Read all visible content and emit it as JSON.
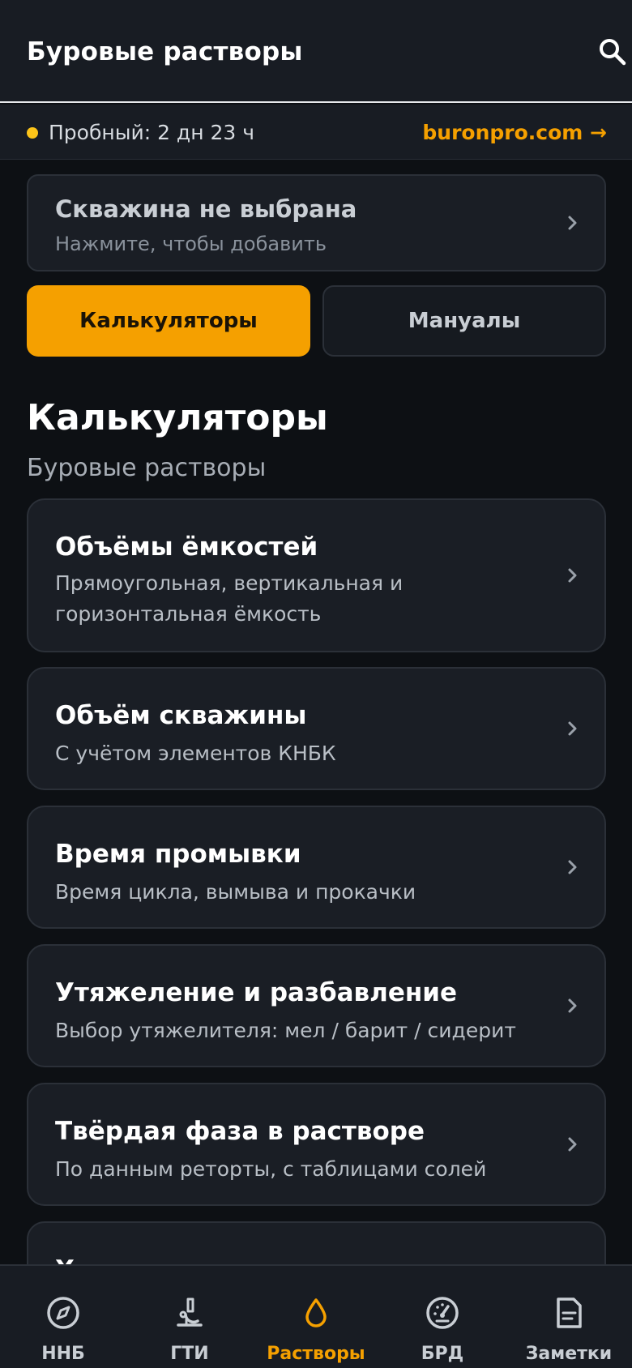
{
  "header": {
    "title": "Буровые растворы",
    "search_icon": "search-icon"
  },
  "trial": {
    "text": "Пробный: 2 дн 23 ч",
    "link": "buronpro.com →",
    "dot_color": "#fcc419"
  },
  "well": {
    "title": "Скважина не выбрана",
    "subtitle": "Нажмите, чтобы добавить"
  },
  "tabs": [
    {
      "label": "Калькуляторы",
      "active": true
    },
    {
      "label": "Мануалы",
      "active": false
    }
  ],
  "section": {
    "title": "Калькуляторы",
    "subtitle": "Буровые растворы"
  },
  "cards": [
    {
      "title": "Объёмы ёмкостей",
      "desc": "Прямоугольная, вертикальная и горизонтальная ёмкость"
    },
    {
      "title": "Объём скважины",
      "desc": "С учётом элементов КНБК"
    },
    {
      "title": "Время промывки",
      "desc": "Время цикла, вымыва и прокачки"
    },
    {
      "title": "Утяжеление и разбавление",
      "desc": "Выбор утяжелителя: мел / барит / сидерит"
    },
    {
      "title": "Твёрдая фаза в растворе",
      "desc": "По данным реторты, с таблицами солей"
    },
    {
      "title": "Х",
      "desc": ""
    }
  ],
  "nav": [
    {
      "label": "ННБ",
      "icon": "compass-icon",
      "active": false
    },
    {
      "label": "ГТИ",
      "icon": "microscope-icon",
      "active": false
    },
    {
      "label": "Растворы",
      "icon": "droplet-icon",
      "active": true
    },
    {
      "label": "БРД",
      "icon": "gauge-icon",
      "active": false
    },
    {
      "label": "Заметки",
      "icon": "note-icon",
      "active": false
    }
  ],
  "colors": {
    "accent": "#f5a000",
    "background": "#0d1014",
    "surface": "#1a1e25",
    "border": "#2b3038"
  }
}
